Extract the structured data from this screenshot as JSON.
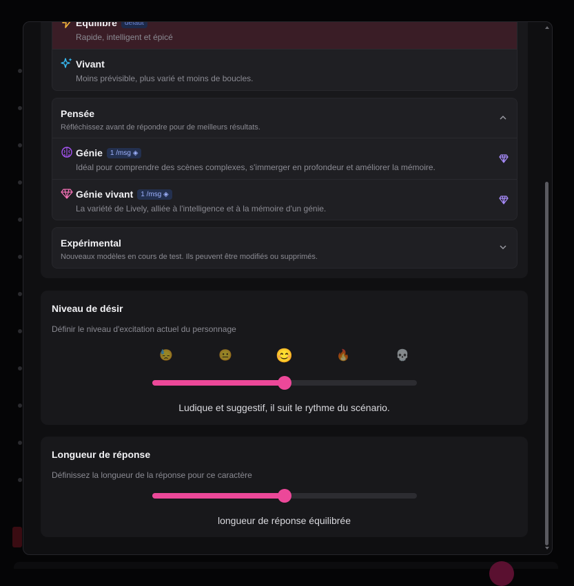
{
  "models": {
    "top_options": [
      {
        "title": "Equilibre",
        "badge": "défaut",
        "desc": "Rapide, intelligent et épicé",
        "icon": "lightning-icon"
      },
      {
        "title": "Vivant",
        "desc": "Moins prévisible, plus varié et moins de boucles.",
        "icon": "sparkles-icon"
      }
    ],
    "pensee": {
      "title": "Pensée",
      "desc": "Réfléchissez avant de répondre pour de meilleurs résultats.",
      "options": [
        {
          "title": "Génie",
          "badge": "1 /msg",
          "desc": "Idéal pour comprendre des scènes complexes, s'immerger en profondeur et améliorer la mémoire.",
          "icon": "brain-icon"
        },
        {
          "title": "Génie vivant",
          "badge": "1 /msg",
          "desc": "La variété de Lively, alliée à l'intelligence et à la mémoire d'un génie.",
          "icon": "gem-icon"
        }
      ]
    },
    "experimental": {
      "title": "Expérimental",
      "desc": "Nouveaux modèles en cours de test. Ils peuvent être modifiés ou supprimés."
    }
  },
  "desire": {
    "title": "Niveau de désir",
    "desc": "Définir le niveau d'excitation actuel du personnage",
    "emojis": [
      "😓",
      "😐",
      "😊",
      "🔥",
      "💀"
    ],
    "level": 0.5,
    "caption": "Ludique et suggestif, il suit le rythme du scénario."
  },
  "length": {
    "title": "Longueur de réponse",
    "desc": "Définissez la longueur de la réponse pour ce caractère",
    "level": 0.5,
    "caption": "longueur de réponse équilibrée"
  },
  "colors": {
    "accent": "#ec4899",
    "selected_bg": "#3a1d26"
  }
}
